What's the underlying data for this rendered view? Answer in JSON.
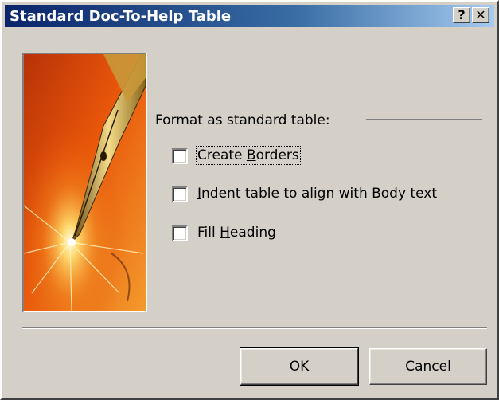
{
  "window": {
    "title": "Standard Doc-To-Help Table",
    "help_glyph": "?",
    "close_glyph": "✕"
  },
  "options": {
    "group_label": "Format as standard table:",
    "items": [
      {
        "pre": "Create ",
        "accel": "B",
        "post": "orders",
        "checked": false,
        "focused": true
      },
      {
        "pre": "",
        "accel": "I",
        "post": "ndent table to align with Body text",
        "checked": false,
        "focused": false
      },
      {
        "pre": "Fill ",
        "accel": "H",
        "post": "eading",
        "checked": false,
        "focused": false
      }
    ]
  },
  "buttons": {
    "ok_label": "OK",
    "cancel_label": "Cancel"
  },
  "colors": {
    "title_start": "#0a246a",
    "title_end": "#a6caf0",
    "face": "#d4d0c8",
    "pic_orange": "#e8560a"
  },
  "icons": [
    "help-icon",
    "close-icon",
    "fountain-pen-image"
  ]
}
